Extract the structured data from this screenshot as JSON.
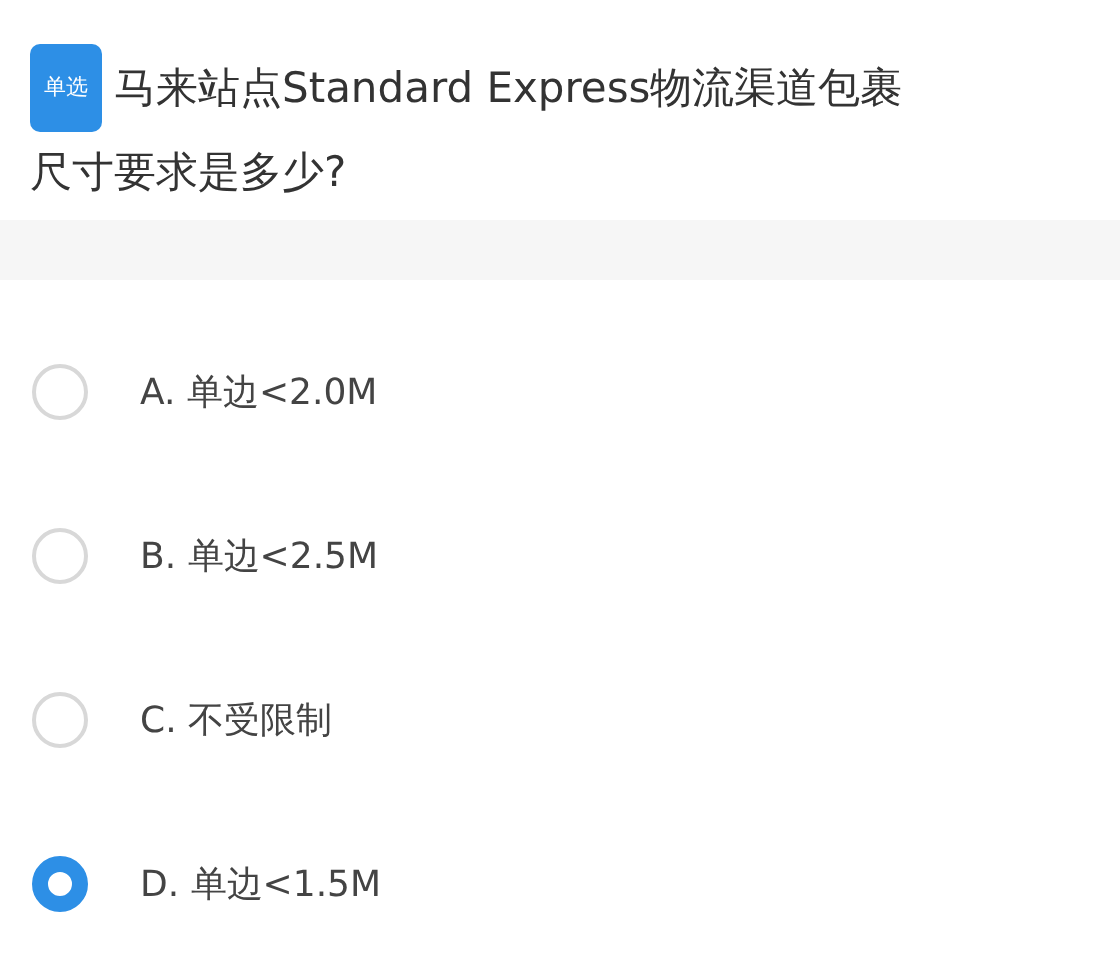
{
  "question": {
    "type_badge": "单选",
    "text": "马来站点Standard Express物流渠道包裹尺寸要求是多少?"
  },
  "options": [
    {
      "label": "A. 单边<2.0M",
      "selected": false
    },
    {
      "label": "B. 单边<2.5M",
      "selected": false
    },
    {
      "label": "C. 不受限制",
      "selected": false
    },
    {
      "label": "D. 单边<1.5M",
      "selected": true
    }
  ]
}
